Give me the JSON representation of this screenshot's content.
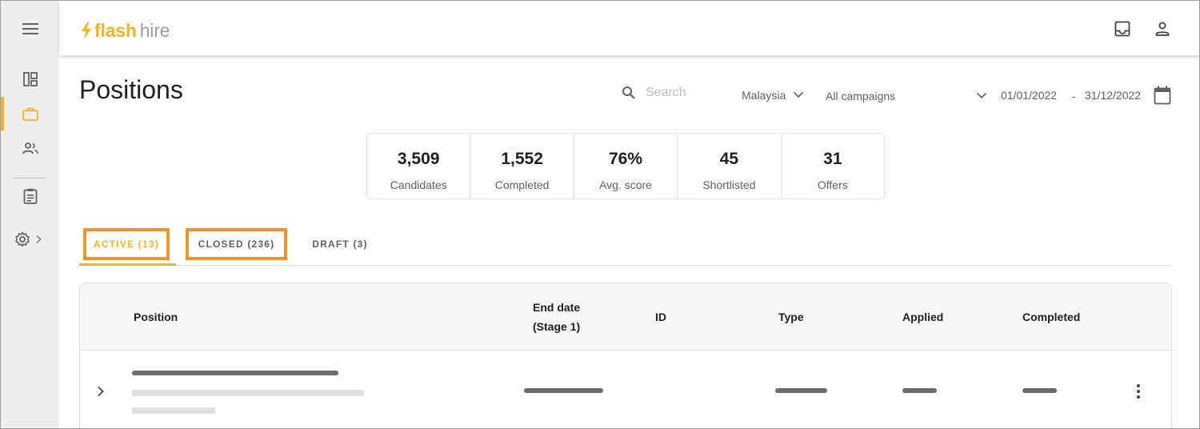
{
  "app": {
    "logo_flash": "flash",
    "logo_hire": "hire",
    "brand_color": "#f5b324",
    "highlight_color": "#f0932b"
  },
  "sidebar": {
    "items": [
      {
        "name": "menu",
        "icon": "menu-icon"
      },
      {
        "name": "dashboard",
        "icon": "dashboard-icon"
      },
      {
        "name": "positions",
        "icon": "briefcase-icon",
        "active": true
      },
      {
        "name": "candidates",
        "icon": "people-icon"
      },
      {
        "name": "reports",
        "icon": "clipboard-icon"
      },
      {
        "name": "settings",
        "icon": "gear-icon",
        "expand_icon": "chevron-right-icon"
      }
    ]
  },
  "header": {
    "icons": [
      "inbox-icon",
      "account-icon"
    ]
  },
  "page": {
    "title": "Positions"
  },
  "filters": {
    "search_placeholder": "Search",
    "country": "Malaysia",
    "campaign": "All campaigns",
    "date_from": "01/01/2022",
    "date_sep": "-",
    "date_to": "31/12/2022"
  },
  "stats": [
    {
      "value": "3,509",
      "label": "Candidates"
    },
    {
      "value": "1,552",
      "label": "Completed"
    },
    {
      "value": "76%",
      "label": "Avg. score"
    },
    {
      "value": "45",
      "label": "Shortlisted"
    },
    {
      "value": "31",
      "label": "Offers"
    }
  ],
  "tabs": [
    {
      "label": "ACTIVE (13)",
      "active": true
    },
    {
      "label": "CLOSED (236)",
      "active": false
    },
    {
      "label": "DRAFT (3)",
      "active": false
    }
  ],
  "table": {
    "columns": {
      "position": "Position",
      "end_date_line1": "End date",
      "end_date_line2": "(Stage 1)",
      "id": "ID",
      "type": "Type",
      "applied": "Applied",
      "completed": "Completed"
    }
  }
}
